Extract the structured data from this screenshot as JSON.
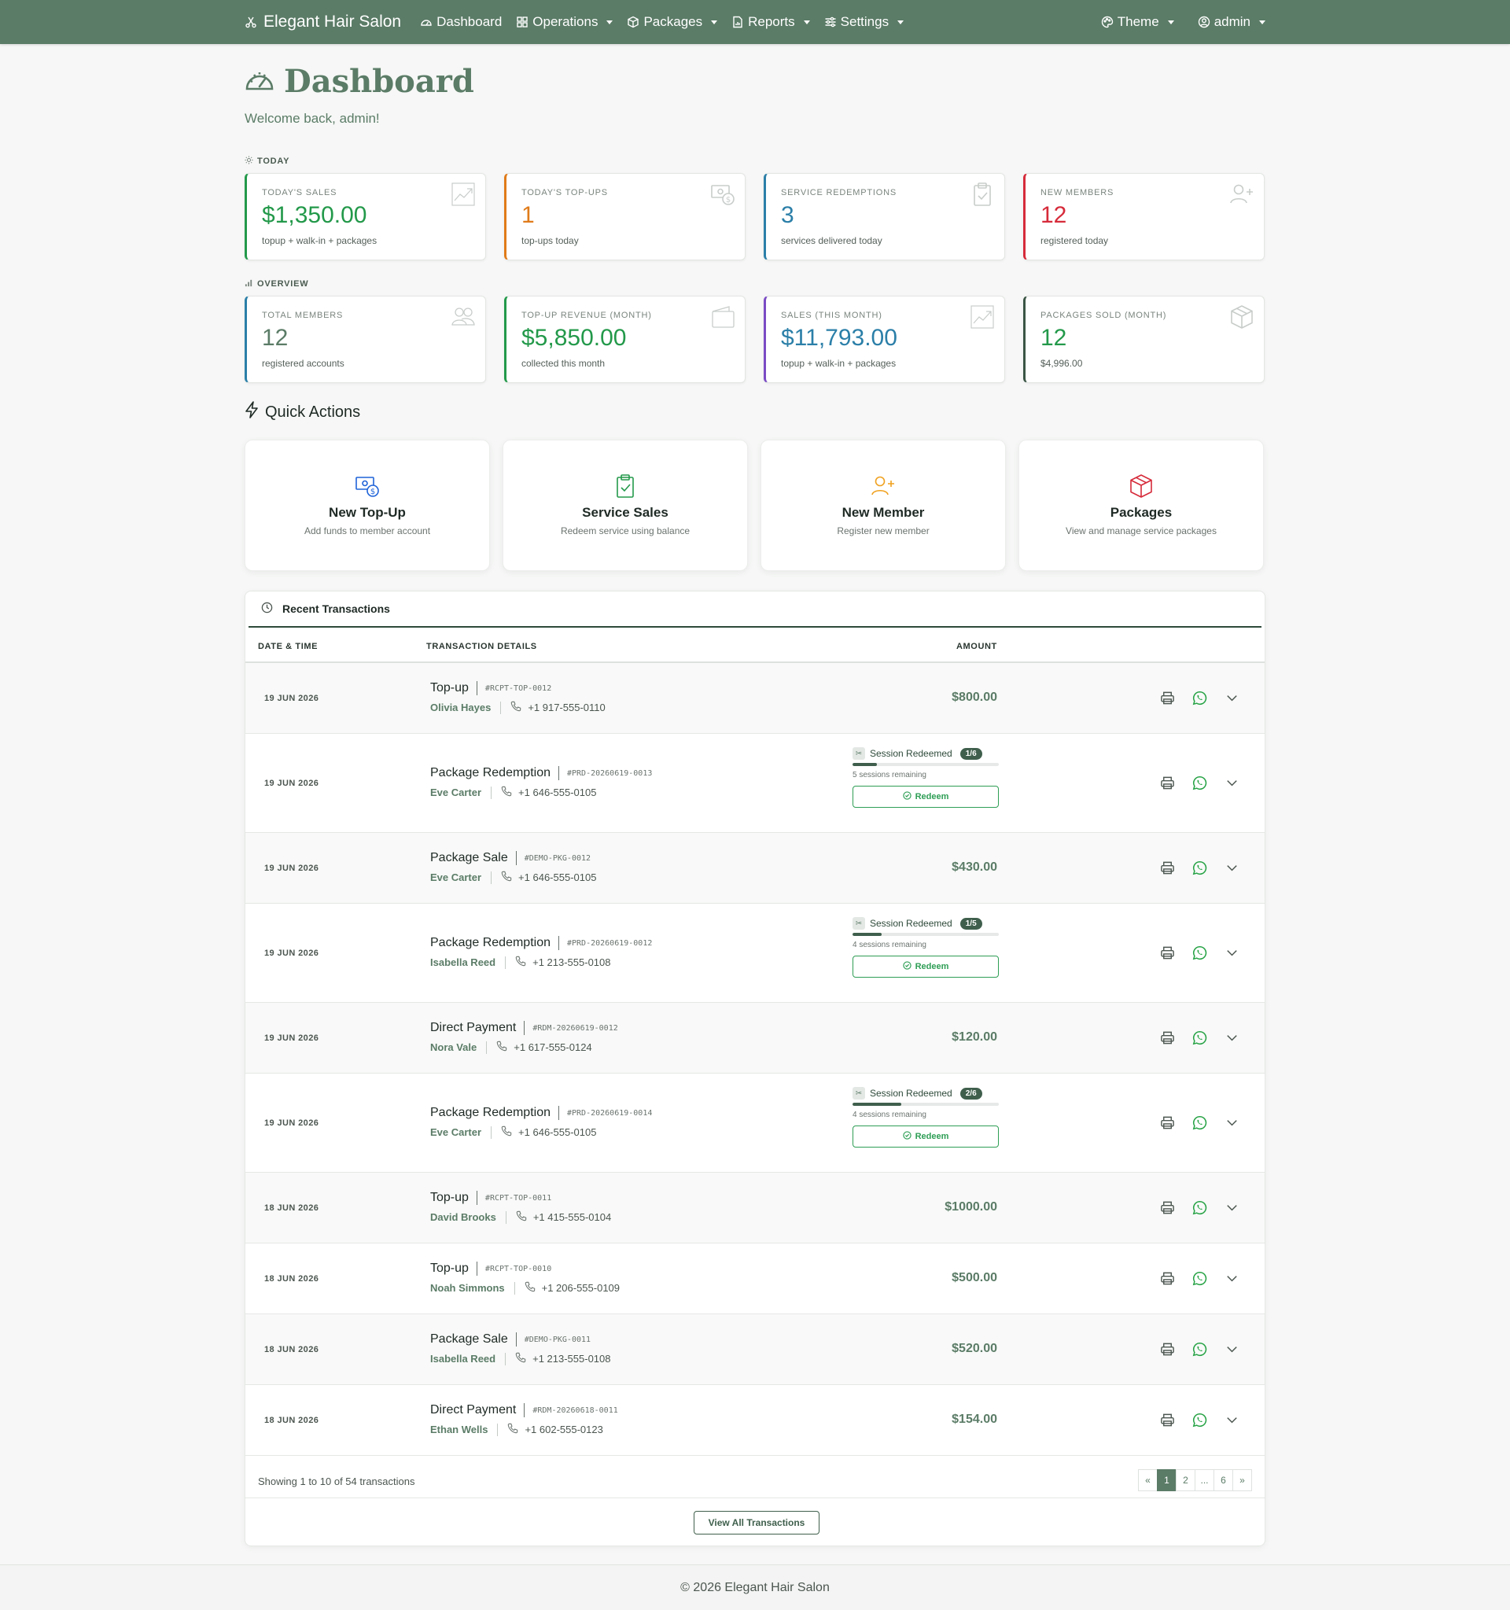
{
  "nav": {
    "brand": "Elegant Hair Salon",
    "items": [
      "Dashboard",
      "Operations",
      "Packages",
      "Reports",
      "Settings"
    ],
    "theme": "Theme",
    "user": "admin"
  },
  "header": {
    "title": "Dashboard",
    "welcome": "Welcome back, admin!"
  },
  "today": {
    "label": "TODAY",
    "cards": [
      {
        "label": "TODAY'S SALES",
        "value": "$1,350.00",
        "sub": "topup + walk-in + packages",
        "color": "#23994a",
        "icon": "chart-up-icon"
      },
      {
        "label": "TODAY'S TOP-UPS",
        "value": "1",
        "sub": "top-ups today",
        "color": "#e07b1a",
        "icon": "cash-coin-icon"
      },
      {
        "label": "SERVICE REDEMPTIONS",
        "value": "3",
        "sub": "services delivered today",
        "color": "#2b7fa8",
        "icon": "clipboard-check-icon"
      },
      {
        "label": "NEW MEMBERS",
        "value": "12",
        "sub": "registered today",
        "color": "#d62b3a",
        "icon": "person-plus-icon"
      }
    ]
  },
  "overview": {
    "label": "OVERVIEW",
    "cards": [
      {
        "label": "TOTAL MEMBERS",
        "value": "12",
        "sub": "registered accounts",
        "color": "#2b7fa8",
        "valueColor": "#5b7c67",
        "icon": "people-icon"
      },
      {
        "label": "TOP-UP REVENUE (MONTH)",
        "value": "$5,850.00",
        "sub": "collected this month",
        "color": "#23994a",
        "valueColor": "#23994a",
        "icon": "wallet-icon"
      },
      {
        "label": "SALES (THIS MONTH)",
        "value": "$11,793.00",
        "sub": "topup + walk-in + packages",
        "color": "#7a4bc4",
        "valueColor": "#2b7fa8",
        "icon": "chart-up-icon"
      },
      {
        "label": "PACKAGES SOLD (MONTH)",
        "value": "12",
        "sub": "$4,996.00",
        "color": "#3a5444",
        "valueColor": "#23994a",
        "icon": "box-icon"
      }
    ]
  },
  "quick_actions": {
    "title": "Quick Actions",
    "items": [
      {
        "name": "New Top-Up",
        "desc": "Add funds to member account",
        "color": "#1f63d8",
        "icon": "cash-coin-icon"
      },
      {
        "name": "Service Sales",
        "desc": "Redeem service using balance",
        "color": "#23994a",
        "icon": "clipboard-check-icon"
      },
      {
        "name": "New Member",
        "desc": "Register new member",
        "color": "#f0a11f",
        "icon": "person-plus-icon"
      },
      {
        "name": "Packages",
        "desc": "View and manage service packages",
        "color": "#d62b3a",
        "icon": "box-icon"
      }
    ]
  },
  "transactions": {
    "title": "Recent Transactions",
    "columns": [
      "DATE & TIME",
      "TRANSACTION DETAILS",
      "AMOUNT"
    ],
    "rows": [
      {
        "date": "19 JUN 2026",
        "type": "Top-up",
        "ref": "#RCPT-TOP-0012",
        "name": "Olivia Hayes",
        "phone": "+1 917-555-0110",
        "amount": "$800.00"
      },
      {
        "date": "19 JUN 2026",
        "type": "Package Redemption",
        "ref": "#PRD-20260619-0013",
        "name": "Eve Carter",
        "phone": "+1 646-555-0105",
        "session": {
          "label": "Session Redeemed",
          "badge": "1/6",
          "progress": 0.167,
          "remaining": "5 sessions remaining",
          "button": "Redeem"
        }
      },
      {
        "date": "19 JUN 2026",
        "type": "Package Sale",
        "ref": "#DEMO-PKG-0012",
        "name": "Eve Carter",
        "phone": "+1 646-555-0105",
        "amount": "$430.00"
      },
      {
        "date": "19 JUN 2026",
        "type": "Package Redemption",
        "ref": "#PRD-20260619-0012",
        "name": "Isabella Reed",
        "phone": "+1 213-555-0108",
        "session": {
          "label": "Session Redeemed",
          "badge": "1/5",
          "progress": 0.2,
          "remaining": "4 sessions remaining",
          "button": "Redeem"
        }
      },
      {
        "date": "19 JUN 2026",
        "type": "Direct Payment",
        "ref": "#RDM-20260619-0012",
        "name": "Nora Vale",
        "phone": "+1 617-555-0124",
        "amount": "$120.00"
      },
      {
        "date": "19 JUN 2026",
        "type": "Package Redemption",
        "ref": "#PRD-20260619-0014",
        "name": "Eve Carter",
        "phone": "+1 646-555-0105",
        "session": {
          "label": "Session Redeemed",
          "badge": "2/6",
          "progress": 0.333,
          "remaining": "4 sessions remaining",
          "button": "Redeem"
        }
      },
      {
        "date": "18 JUN 2026",
        "type": "Top-up",
        "ref": "#RCPT-TOP-0011",
        "name": "David Brooks",
        "phone": "+1 415-555-0104",
        "amount": "$1000.00"
      },
      {
        "date": "18 JUN 2026",
        "type": "Top-up",
        "ref": "#RCPT-TOP-0010",
        "name": "Noah Simmons",
        "phone": "+1 206-555-0109",
        "amount": "$500.00"
      },
      {
        "date": "18 JUN 2026",
        "type": "Package Sale",
        "ref": "#DEMO-PKG-0011",
        "name": "Isabella Reed",
        "phone": "+1 213-555-0108",
        "amount": "$520.00"
      },
      {
        "date": "18 JUN 2026",
        "type": "Direct Payment",
        "ref": "#RDM-20260618-0011",
        "name": "Ethan Wells",
        "phone": "+1 602-555-0123",
        "amount": "$154.00"
      }
    ],
    "showing": "Showing 1 to 10 of 54 transactions",
    "pages": [
      "«",
      "1",
      "2",
      "...",
      "6",
      "»"
    ],
    "active_page": "1",
    "view_all": "View All Transactions"
  },
  "footer": "© 2026 Elegant Hair Salon"
}
